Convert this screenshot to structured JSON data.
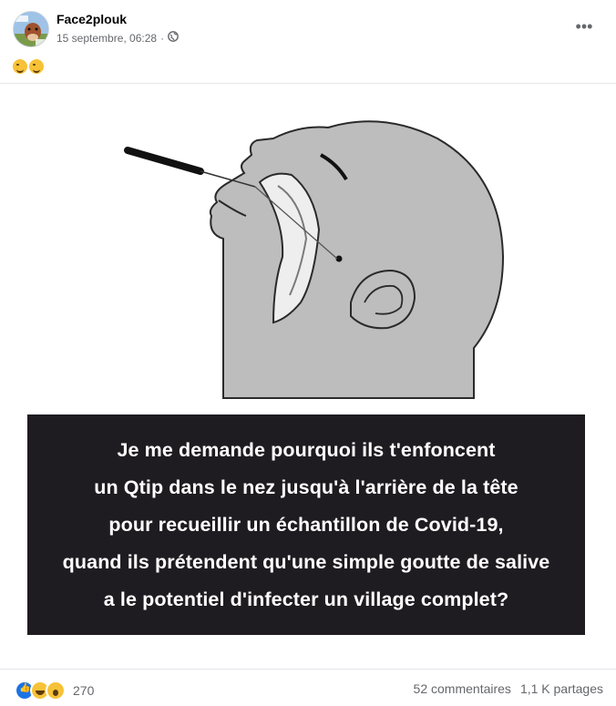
{
  "post": {
    "author": "Face2plouk",
    "date": "15 septembre, 06:28",
    "separator": "·",
    "caption_emojis": [
      "wink-emoji",
      "wink-emoji"
    ],
    "image_text": [
      "Je me demande pourquoi ils t'enfoncent",
      "un Qtip dans le nez jusqu'à l'arrière de la tête",
      "pour recueillir un échantillon de Covid-19,",
      "quand ils prétendent qu'une simple goutte de salive",
      "a le potentiel d'infecter un village complet?"
    ],
    "reactions": [
      "like",
      "haha",
      "wow"
    ],
    "reaction_count": "270",
    "comments": "52 commentaires",
    "shares": "1,1 K partages"
  }
}
